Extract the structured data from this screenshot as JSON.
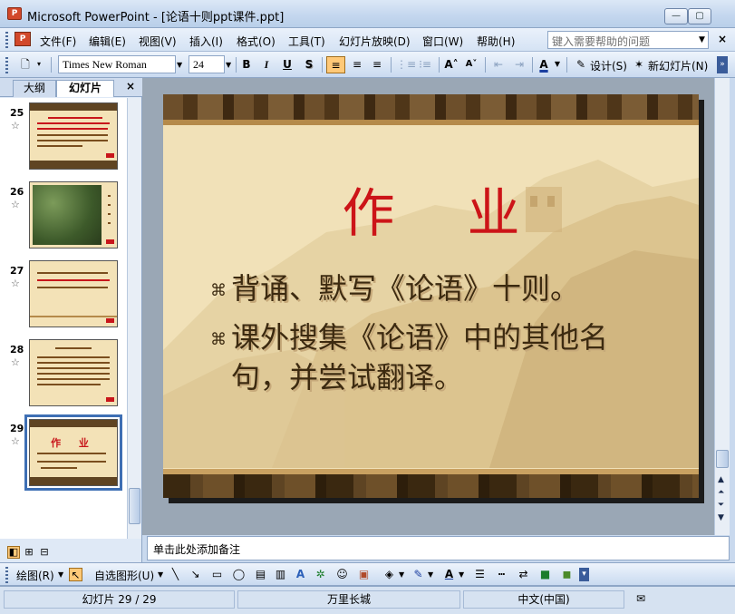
{
  "window": {
    "title": "Microsoft PowerPoint - [论语十则ppt课件.ppt]",
    "app_icon_label": "P",
    "min_label": "—",
    "max_label": "▢",
    "close_label": "✕"
  },
  "menu": {
    "items": [
      "文件(F)",
      "编辑(E)",
      "视图(V)",
      "插入(I)",
      "格式(O)",
      "工具(T)",
      "幻灯片放映(D)",
      "窗口(W)",
      "帮助(H)"
    ],
    "help_placeholder": "键入需要帮助的问题",
    "close_label": "×"
  },
  "toolbar": {
    "font_name": "Times New Roman",
    "font_size": "24",
    "bold": "B",
    "italic": "I",
    "underline": "U",
    "shadow": "S",
    "design_label": "设计(S)",
    "new_slide_label": "新幻灯片(N)"
  },
  "left_panel": {
    "tab_outline": "大纲",
    "tab_slides": "幻灯片",
    "close_label": "×",
    "slides": [
      {
        "num": "25"
      },
      {
        "num": "26"
      },
      {
        "num": "27"
      },
      {
        "num": "28"
      },
      {
        "num": "29",
        "title": "作 业"
      }
    ],
    "star": "☆"
  },
  "slide": {
    "title": "作业",
    "bullet_mark": "⌘",
    "bullets": [
      "背诵、默写《论语》十则。",
      "课外搜集《论语》中的其他名",
      "句，并尝试翻译。"
    ]
  },
  "notes": {
    "placeholder": "单击此处添加备注"
  },
  "drawing_toolbar": {
    "draw_label": "绘图(R)",
    "autoshape_label": "自选图形(U)"
  },
  "status": {
    "slide_info": "幻灯片 29 / 29",
    "design_name": "万里长城",
    "language": "中文(中国)"
  },
  "colors": {
    "title_red": "#cc1418",
    "body_brown": "#3c2a10",
    "slide_bg": "#f1e1b8"
  }
}
